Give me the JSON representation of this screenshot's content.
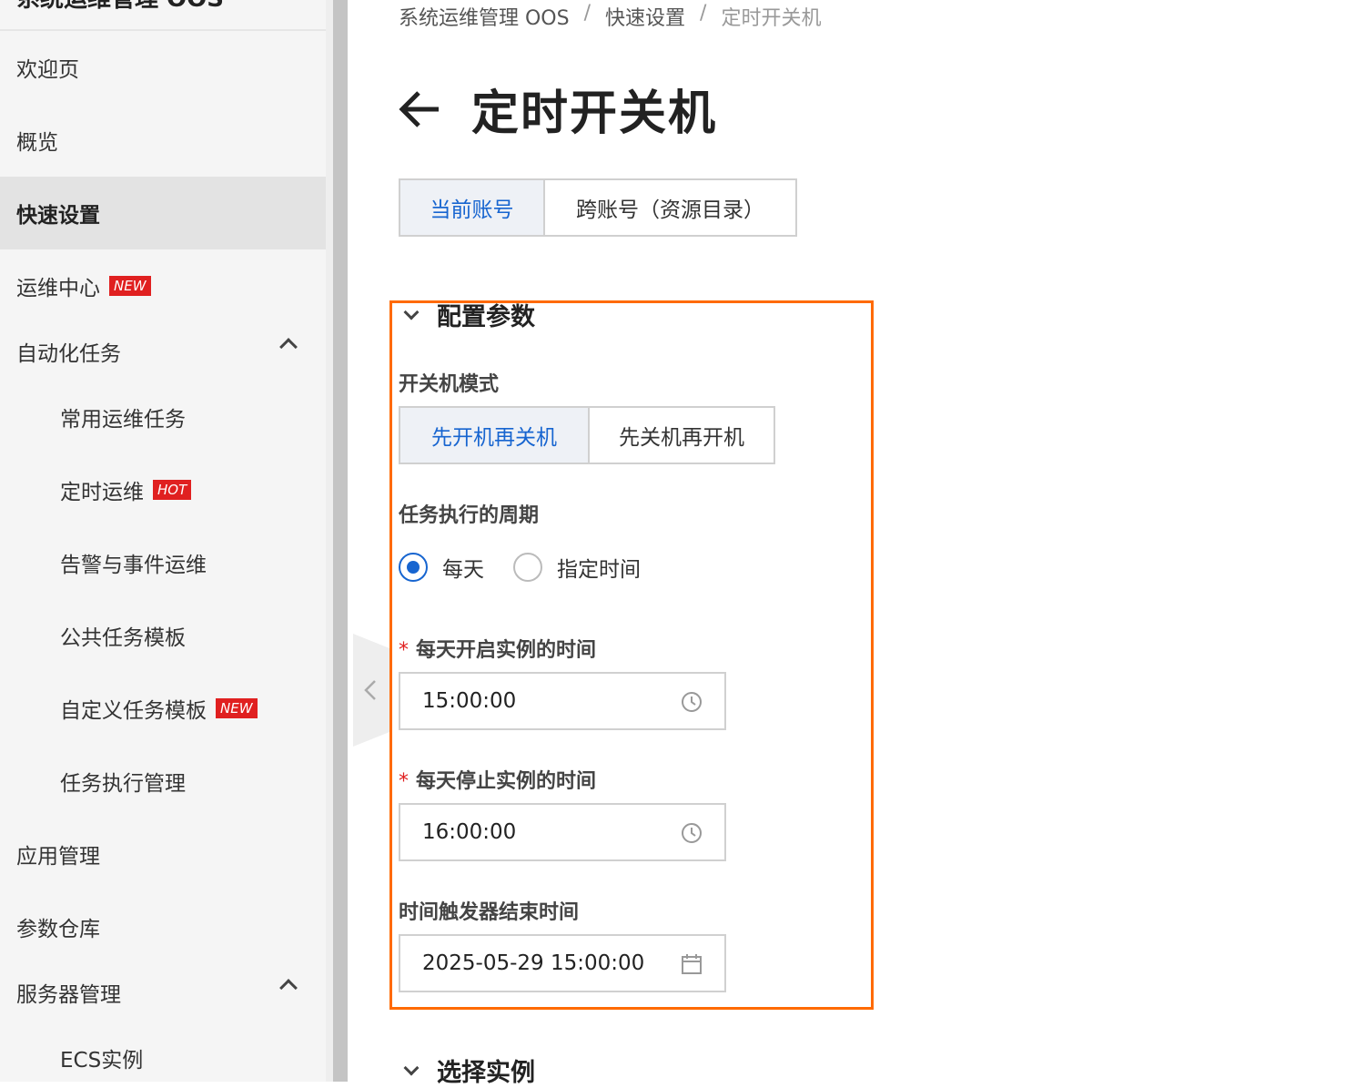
{
  "sidebar": {
    "title": "系统运维管理 OOS",
    "items": [
      {
        "label": "欢迎页"
      },
      {
        "label": "概览"
      },
      {
        "label": "快速设置"
      },
      {
        "label": "运维中心",
        "badge": "NEW"
      },
      {
        "label": "自动化任务"
      },
      {
        "label": "常用运维任务"
      },
      {
        "label": "定时运维",
        "badge": "HOT"
      },
      {
        "label": "告警与事件运维"
      },
      {
        "label": "公共任务模板"
      },
      {
        "label": "自定义任务模板",
        "badge": "NEW"
      },
      {
        "label": "任务执行管理"
      },
      {
        "label": "应用管理"
      },
      {
        "label": "参数仓库"
      },
      {
        "label": "服务器管理"
      },
      {
        "label": "ECS实例"
      }
    ]
  },
  "breadcrumb": {
    "items": [
      "系统运维管理 OOS",
      "快速设置",
      "定时开关机"
    ],
    "separator": "/"
  },
  "page": {
    "title": "定时开关机"
  },
  "account_tabs": {
    "options": [
      "当前账号",
      "跨账号（资源目录）"
    ],
    "selected": "当前账号"
  },
  "config_section": {
    "title": "配置参数",
    "mode_label": "开关机模式",
    "mode_options": [
      "先开机再关机",
      "先关机再开机"
    ],
    "mode_selected": "先开机再关机",
    "period_label": "任务执行的周期",
    "period_options": [
      "每天",
      "指定时间"
    ],
    "period_selected": "每天",
    "start_label": "每天开启实例的时间",
    "start_value": "15:00:00",
    "stop_label": "每天停止实例的时间",
    "stop_value": "16:00:00",
    "end_label": "时间触发器结束时间",
    "end_value": "2025-05-29 15:00:00",
    "required_mark": "*"
  },
  "instance_section": {
    "title": "选择实例"
  },
  "colors": {
    "accent": "#1765d0",
    "highlight": "#ff6a00",
    "badge": "#e02020"
  }
}
